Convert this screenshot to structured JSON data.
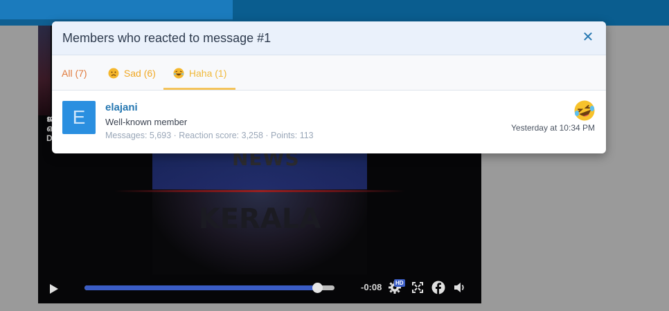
{
  "background": {
    "topbar_color": "#0a5d8f",
    "video": {
      "news_text": "NEWS",
      "logo_text": "KERALA",
      "side_text": [
        "ജ",
        "ഒ",
        "D"
      ],
      "progress": 0.93,
      "time_remaining": "-0:08",
      "hd_label": "HD",
      "icons": [
        "play-icon",
        "gear-icon",
        "fullscreen-icon",
        "facebook-icon",
        "volume-icon"
      ]
    }
  },
  "modal": {
    "title": "Members who reacted to message #1",
    "close_icon": "close-icon",
    "tabs": [
      {
        "label": "All (7)",
        "color": "#e07a3c"
      },
      {
        "label": "Sad (6)",
        "emoji": "sad-emoji-icon",
        "color": "#f0a825"
      },
      {
        "label": "Haha (1)",
        "emoji": "haha-emoji-icon",
        "color": "#f0b93a",
        "active": true
      }
    ],
    "members": [
      {
        "avatar_letter": "E",
        "username": "elajani",
        "user_title": "Well-known member",
        "stats": "Messages: 5,693 · Reaction score: 3,258 · Points: 113",
        "reaction_icon": "haha-emoji-icon",
        "time": "Yesterday at 10:34 PM"
      }
    ]
  }
}
